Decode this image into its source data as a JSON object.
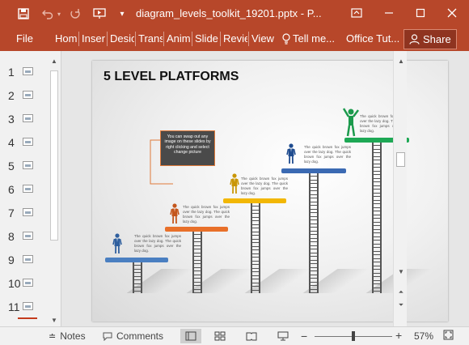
{
  "titlebar": {
    "filename": "diagram_levels_toolkit_19201.pptx - P...",
    "icons": [
      "save-icon",
      "undo-icon",
      "redo-icon",
      "present-from-start-icon",
      "customize-qat-icon"
    ],
    "window_icons": [
      "ribbon-display-options-icon",
      "minimize-icon",
      "maximize-icon",
      "close-icon"
    ]
  },
  "ribbon": {
    "tabs": [
      "File",
      "Hom",
      "Inser",
      "Desic",
      "Trans",
      "Anim",
      "Slide",
      "Revie",
      "View"
    ],
    "tell_me": "Tell me...",
    "office_tutor": "Office Tut...",
    "share": "Share"
  },
  "thumbnails": [
    "1",
    "2",
    "3",
    "4",
    "5",
    "6",
    "7",
    "8",
    "9",
    "10",
    "11"
  ],
  "slide": {
    "title": "5 LEVEL PLATFORMS",
    "callout": "You can swap out any image on these slides by right clicking and select change picture",
    "levels": [
      {
        "color": "#4a7fc1",
        "figure_color": "#2f5f9e",
        "text": "The quick brown fox jumps over the lazy dog. The quick brown fox jumps over the lazy dog."
      },
      {
        "color": "#e8702a",
        "figure_color": "#c4561c",
        "text": "The quick brown fox jumps over the lazy dog. The quick brown fox jumps over the lazy dog."
      },
      {
        "color": "#f2b705",
        "figure_color": "#c99605",
        "text": "The quick brown fox jumps over the lazy dog. The quick brown fox jumps over the lazy dog."
      },
      {
        "color": "#3b6ab3",
        "figure_color": "#1f4c8f",
        "text": "The quick brown fox jumps over the lazy dog. The quick brown fox jumps over the lazy dog."
      },
      {
        "color": "#1ea855",
        "figure_color": "#1b9a4c",
        "text": "The quick brown fox jumps over the lazy dog. The quick brown fox jumps over the lazy dog."
      }
    ]
  },
  "statusbar": {
    "notes": "Notes",
    "comments": "Comments",
    "zoom_minus": "−",
    "zoom_plus": "+",
    "zoom": "57%",
    "views": [
      "normal-view-icon",
      "slide-sorter-icon",
      "reading-view-icon",
      "slideshow-icon"
    ],
    "zoom_fraction": 0.57
  }
}
